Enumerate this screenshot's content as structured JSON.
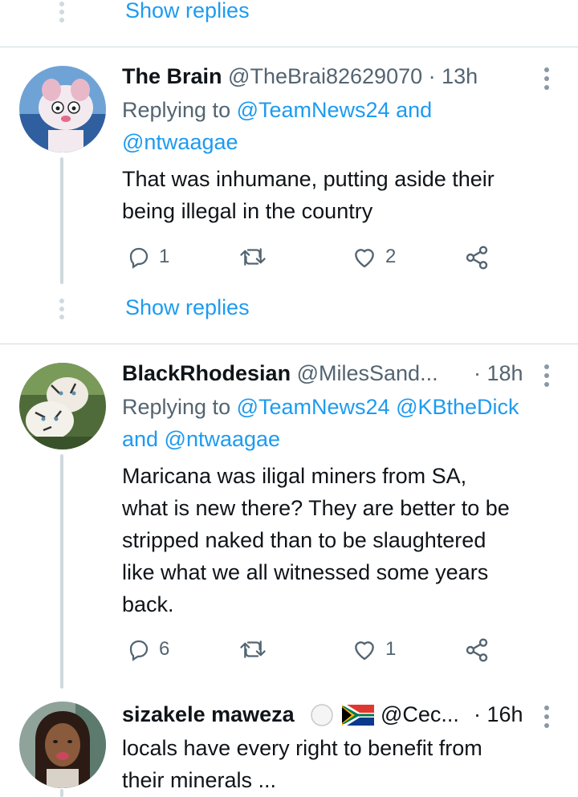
{
  "top": {
    "show_replies": "Show replies"
  },
  "tweets": [
    {
      "name": "The Brain",
      "handle": "@TheBrai82629070",
      "time": "· 13h",
      "reply_prefix": "Replying to ",
      "reply_line1_mentions": "@TeamNews24 and",
      "reply_line2_mentions": "@ntwaagae",
      "text_line1": "That was inhumane, putting aside their",
      "text_line2": "being illegal in the country",
      "replies": "1",
      "retweets": "",
      "likes": "2",
      "show_replies": "Show replies"
    },
    {
      "name": "BlackRhodesian",
      "handle": "@MilesSand...",
      "time": "· 18h",
      "reply_prefix": "Replying to ",
      "reply_line1_mentions": "@TeamNews24 @KBtheDick",
      "reply_line2_mentions": "and @ntwaagae",
      "text_line1": "Maricana was iligal miners from SA,",
      "text_line2": "what is new there? They are better to be",
      "text_line3": "stripped naked than to be slaughtered",
      "text_line4": "like what we all witnessed some years",
      "text_line5": "back.",
      "replies": "6",
      "retweets": "",
      "likes": "1"
    },
    {
      "name": "sizakele maweza",
      "handle": "@Cec...",
      "time": "· 16h",
      "text_line1": "locals have every right to benefit from",
      "text_line2": "their minerals ..."
    }
  ],
  "icons": {
    "reply": "reply-icon",
    "retweet": "retweet-icon",
    "like": "heart-icon",
    "share": "share-icon",
    "more": "more-vertical-icon"
  },
  "colors": {
    "link": "#1d9bf0",
    "muted": "#536471",
    "line": "#cfd9de"
  }
}
